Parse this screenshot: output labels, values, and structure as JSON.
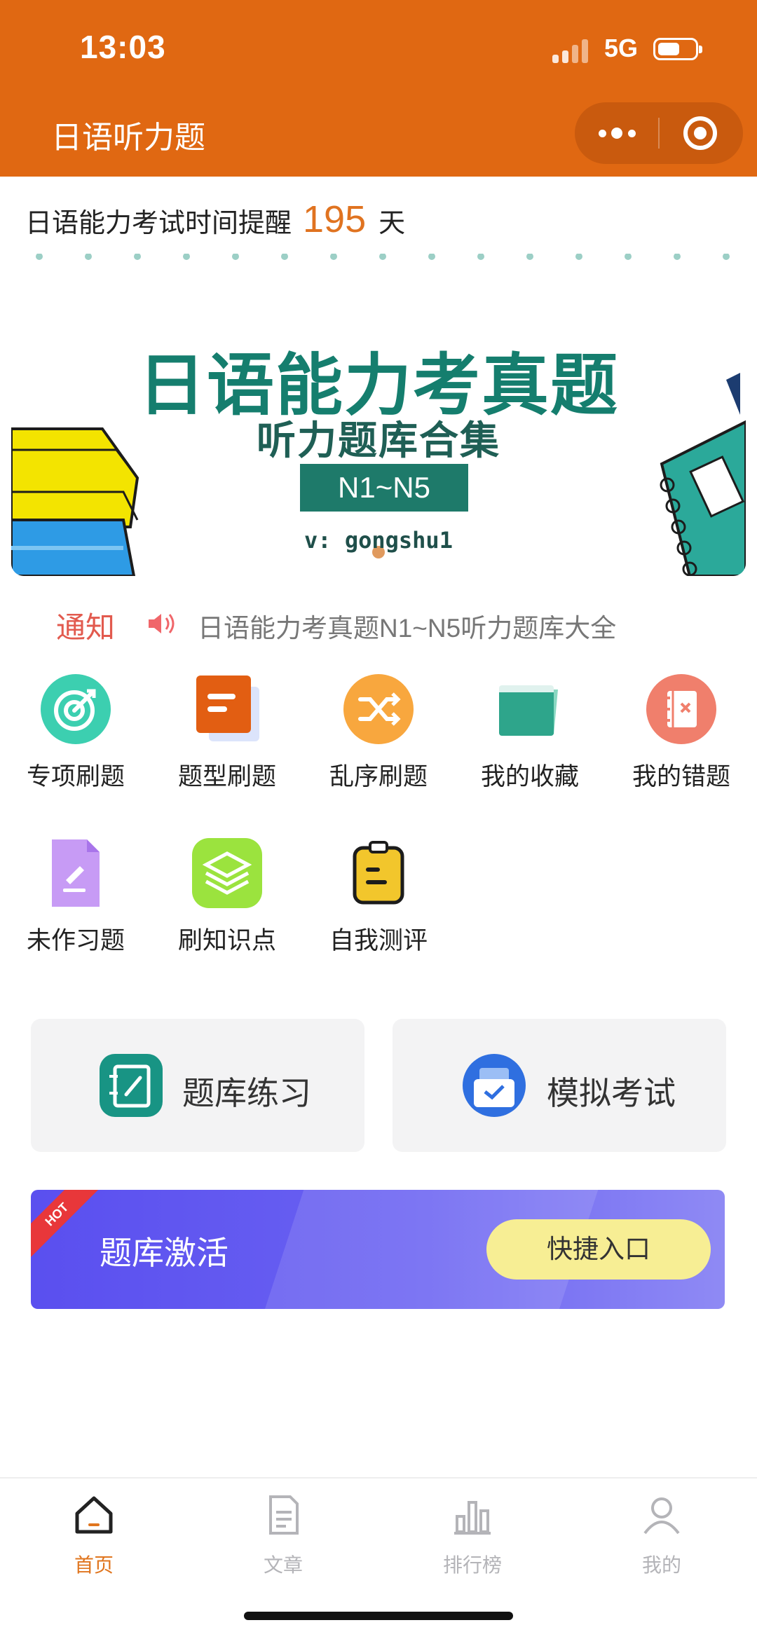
{
  "status_bar": {
    "time": "13:03",
    "network": "5G"
  },
  "header": {
    "title": "日语听力题"
  },
  "countdown": {
    "label": "日语能力考试时间提醒",
    "days": "195",
    "unit": "天"
  },
  "banner": {
    "title": "日语能力考真题",
    "subtitle": "听力题库合集",
    "level": "N1~N5",
    "handle": "v: gongshu1"
  },
  "notice": {
    "tag": "通知",
    "text": "日语能力考真题N1~N5听力题库大全"
  },
  "grid": [
    {
      "label": "专项刷题",
      "icon": "target-icon",
      "color": "#3CCFB0"
    },
    {
      "label": "题型刷题",
      "icon": "document-icon",
      "color": "#E25E12"
    },
    {
      "label": "乱序刷题",
      "icon": "shuffle-icon",
      "color": "#F8A73E"
    },
    {
      "label": "我的收藏",
      "icon": "folder-icon",
      "color": "#2EA58B"
    },
    {
      "label": "我的错题",
      "icon": "notebook-x-icon",
      "color": "#F07F6C"
    },
    {
      "label": "未作习题",
      "icon": "edit-file-icon",
      "color": "#C79BF5"
    },
    {
      "label": "刷知识点",
      "icon": "layers-icon",
      "color": "#9BE33E"
    },
    {
      "label": "自我测评",
      "icon": "clipboard-icon",
      "color": "#F2C62C"
    }
  ],
  "cards": [
    {
      "label": "题库练习",
      "icon": "practice-icon",
      "color": "#189484"
    },
    {
      "label": "模拟考试",
      "icon": "exam-icon",
      "color": "#2F6FE0"
    }
  ],
  "activation": {
    "badge": "HOT",
    "title": "题库激活",
    "button": "快捷入口"
  },
  "tabbar": [
    {
      "label": "首页",
      "icon": "home-icon",
      "active": true
    },
    {
      "label": "文章",
      "icon": "article-icon",
      "active": false
    },
    {
      "label": "排行榜",
      "icon": "ranking-icon",
      "active": false
    },
    {
      "label": "我的",
      "icon": "profile-icon",
      "active": false
    }
  ],
  "colors": {
    "header": "#E06812",
    "accent": "#E0751E",
    "notice": "#E25A4E",
    "activation": "#5A4FEF"
  }
}
